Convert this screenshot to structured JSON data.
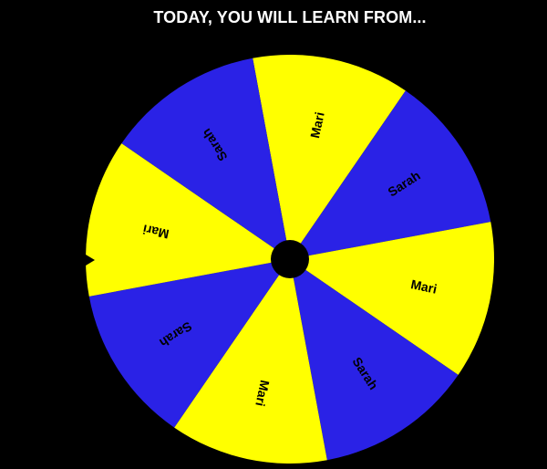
{
  "title": "TODAY, YOU WILL LEARN FROM...",
  "wheel": {
    "segments": [
      {
        "label": "Mari",
        "color": "#ffff00"
      },
      {
        "label": "Sarah",
        "color": "#2a22e6"
      },
      {
        "label": "Mari",
        "color": "#ffff00"
      },
      {
        "label": "Sarah",
        "color": "#2a22e6"
      },
      {
        "label": "Mari",
        "color": "#ffff00"
      },
      {
        "label": "Sarah",
        "color": "#2a22e6"
      },
      {
        "label": "Mari",
        "color": "#ffff00"
      },
      {
        "label": "Sarah",
        "color": "#2a22e6"
      }
    ],
    "hub_color": "#000000",
    "pointer_color": "#000000"
  }
}
